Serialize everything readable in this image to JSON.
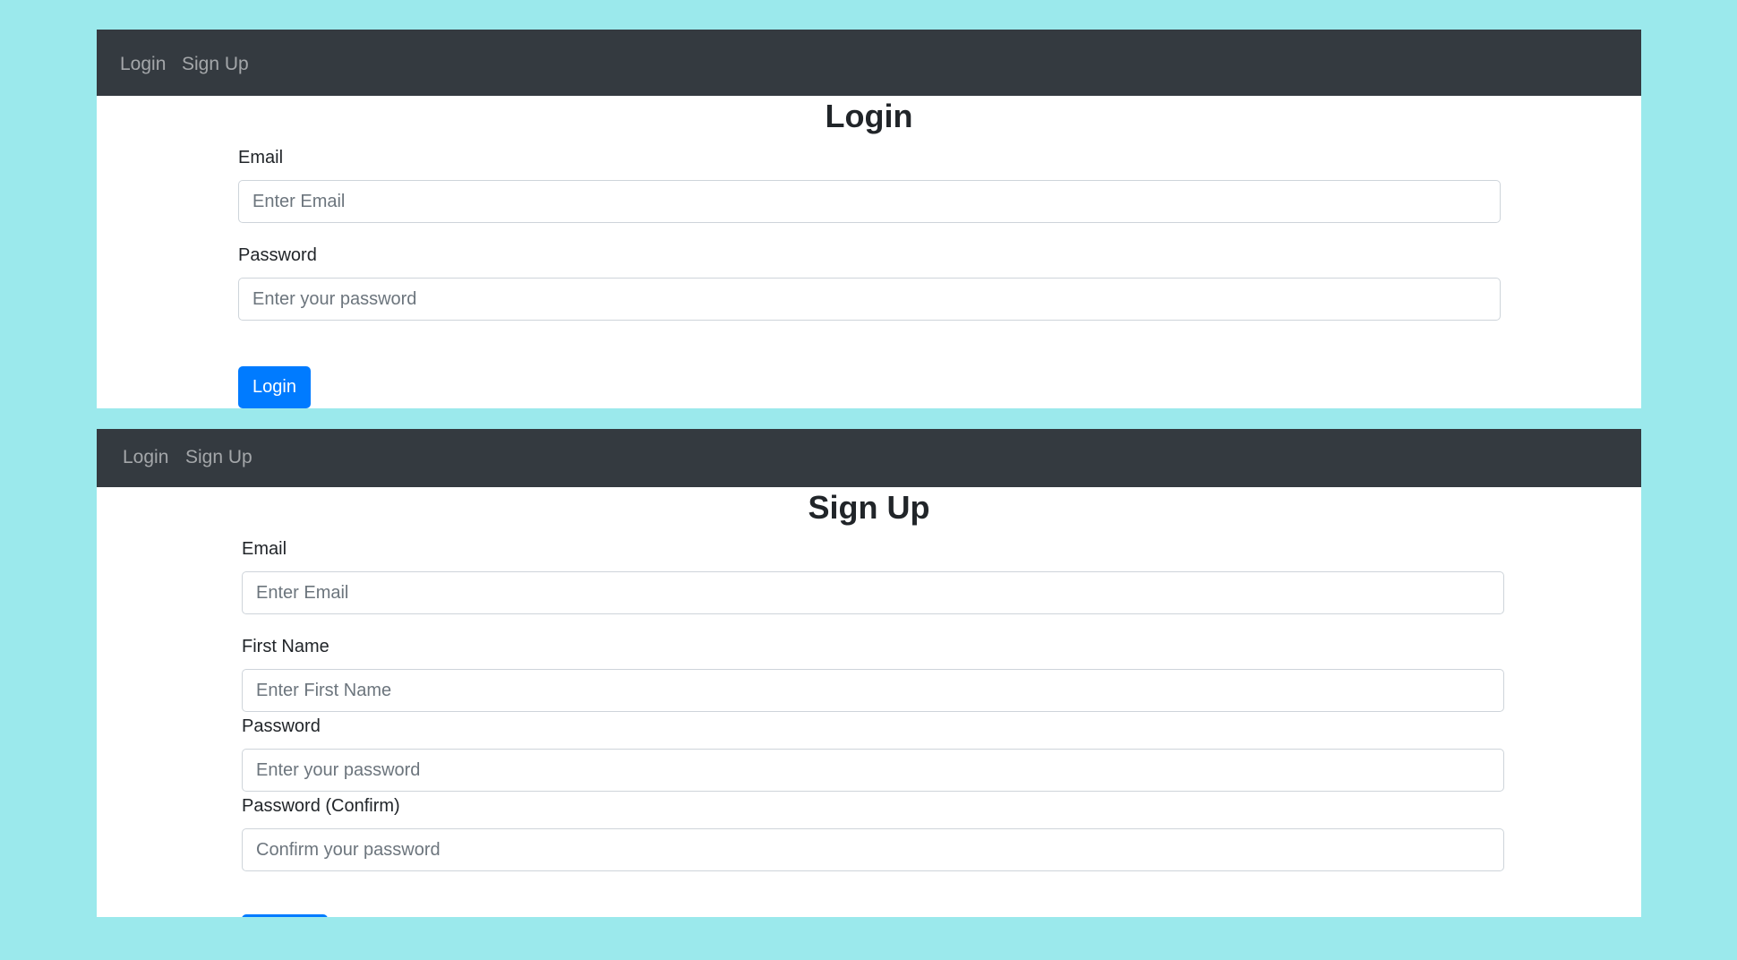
{
  "login_screen": {
    "nav": {
      "login": "Login",
      "signup": "Sign Up"
    },
    "title": "Login",
    "email": {
      "label": "Email",
      "placeholder": "Enter Email"
    },
    "password": {
      "label": "Password",
      "placeholder": "Enter your password"
    },
    "submit_label": "Login"
  },
  "signup_screen": {
    "nav": {
      "login": "Login",
      "signup": "Sign Up"
    },
    "title": "Sign Up",
    "email": {
      "label": "Email",
      "placeholder": "Enter Email"
    },
    "first_name": {
      "label": "First Name",
      "placeholder": "Enter First Name"
    },
    "password": {
      "label": "Password",
      "placeholder": "Enter your password"
    },
    "password_confirm": {
      "label": "Password (Confirm)",
      "placeholder": "Confirm your password"
    }
  },
  "colors": {
    "background": "#9be9ec",
    "navbar": "#343a40",
    "primary": "#007bff"
  }
}
